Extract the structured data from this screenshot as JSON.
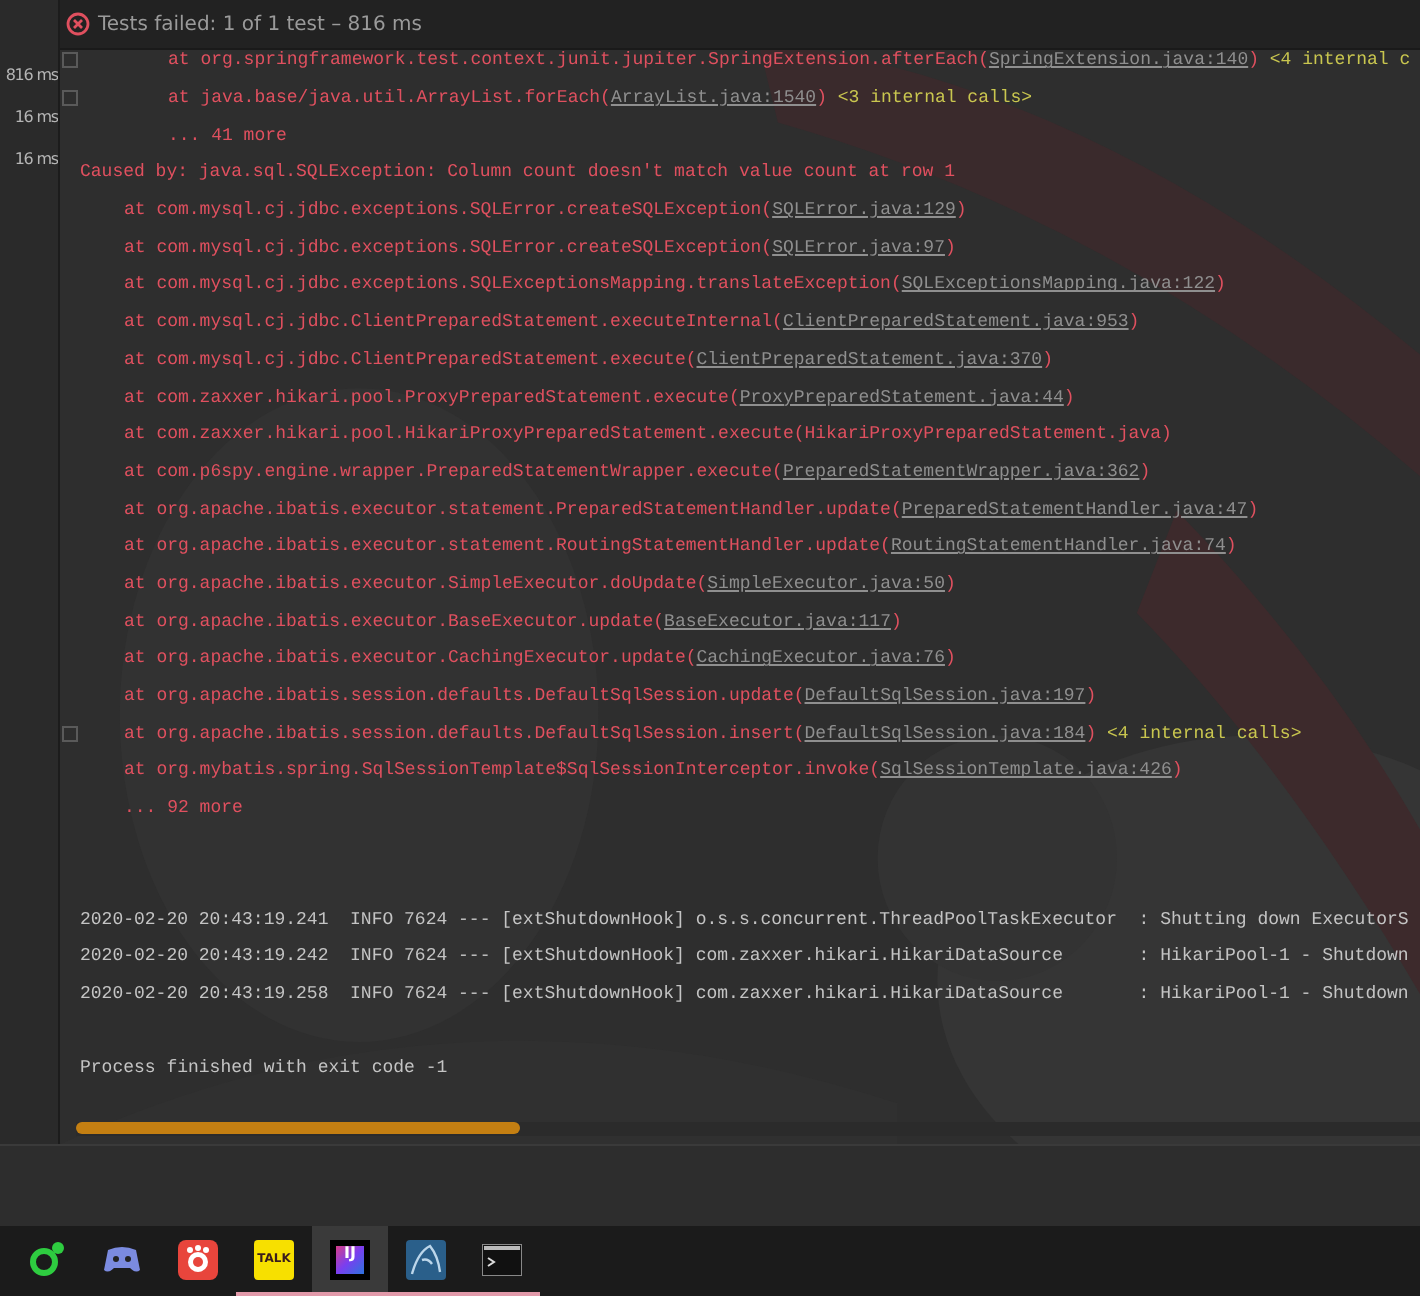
{
  "durations": [
    "816 ms",
    "16 ms",
    "16 ms"
  ],
  "header": {
    "status": "Tests failed: 1 of 1 test – 816 ms"
  },
  "trace": {
    "frames": [
      {
        "call": "at org.springframework.test.context.junit.jupiter.SpringExtension.afterEach(",
        "link": "SpringExtension.java:140",
        "close": ")",
        "note": "<4 internal c",
        "fold": true
      },
      {
        "call": "at java.base/java.util.ArrayList.forEach(",
        "link": "ArrayList.java:1540",
        "close": ")",
        "note": "<3 internal calls>",
        "fold": true
      }
    ],
    "more": "... 41 more"
  },
  "cause": {
    "text": "Caused by: java.sql.SQLException: Column count doesn't match value count at row 1",
    "frames": [
      {
        "call": "at com.mysql.cj.jdbc.exceptions.SQLError.createSQLException(",
        "link": "SQLError.java:129",
        "close": ")",
        "fold": false
      },
      {
        "call": "at com.mysql.cj.jdbc.exceptions.SQLError.createSQLException(",
        "link": "SQLError.java:97",
        "close": ")",
        "fold": false
      },
      {
        "call": "at com.mysql.cj.jdbc.exceptions.SQLExceptionsMapping.translateException(",
        "link": "SQLExceptionsMapping.java:122",
        "close": ")",
        "fold": false
      },
      {
        "call": "at com.mysql.cj.jdbc.ClientPreparedStatement.executeInternal(",
        "link": "ClientPreparedStatement.java:953",
        "close": ")",
        "fold": false
      },
      {
        "call": "at com.mysql.cj.jdbc.ClientPreparedStatement.execute(",
        "link": "ClientPreparedStatement.java:370",
        "close": ")",
        "fold": false
      },
      {
        "call": "at com.zaxxer.hikari.pool.ProxyPreparedStatement.execute(",
        "link": "ProxyPreparedStatement.java:44",
        "close": ")",
        "fold": false
      },
      {
        "call": "at com.zaxxer.hikari.pool.HikariProxyPreparedStatement.execute(HikariProxyPreparedStatement.java)",
        "fold": false
      },
      {
        "call": "at com.p6spy.engine.wrapper.PreparedStatementWrapper.execute(",
        "link": "PreparedStatementWrapper.java:362",
        "close": ")",
        "fold": false
      },
      {
        "call": "at org.apache.ibatis.executor.statement.PreparedStatementHandler.update(",
        "link": "PreparedStatementHandler.java:47",
        "close": ")",
        "fold": false
      },
      {
        "call": "at org.apache.ibatis.executor.statement.RoutingStatementHandler.update(",
        "link": "RoutingStatementHandler.java:74",
        "close": ")",
        "fold": false
      },
      {
        "call": "at org.apache.ibatis.executor.SimpleExecutor.doUpdate(",
        "link": "SimpleExecutor.java:50",
        "close": ")",
        "fold": false
      },
      {
        "call": "at org.apache.ibatis.executor.BaseExecutor.update(",
        "link": "BaseExecutor.java:117",
        "close": ")",
        "fold": false
      },
      {
        "call": "at org.apache.ibatis.executor.CachingExecutor.update(",
        "link": "CachingExecutor.java:76",
        "close": ")",
        "fold": false
      },
      {
        "call": "at org.apache.ibatis.session.defaults.DefaultSqlSession.update(",
        "link": "DefaultSqlSession.java:197",
        "close": ")",
        "fold": false
      },
      {
        "call": "at org.apache.ibatis.session.defaults.DefaultSqlSession.insert(",
        "link": "DefaultSqlSession.java:184",
        "close": ")",
        "note": "<4 internal calls>",
        "fold": true
      },
      {
        "call": "at org.mybatis.spring.SqlSessionTemplate$SqlSessionInterceptor.invoke(",
        "link": "SqlSessionTemplate.java:426",
        "close": ")",
        "fold": false
      }
    ],
    "more": "... 92 more"
  },
  "log": [
    "2020-02-20 20:43:19.241  INFO 7624 --- [extShutdownHook] o.s.s.concurrent.ThreadPoolTaskExecutor  : Shutting down ExecutorS",
    "2020-02-20 20:43:19.242  INFO 7624 --- [extShutdownHook] com.zaxxer.hikari.HikariDataSource       : HikariPool-1 - Shutdown",
    "2020-02-20 20:43:19.258  INFO 7624 --- [extShutdownHook] com.zaxxer.hikari.HikariDataSource       : HikariPool-1 - Shutdown"
  ],
  "exit": "Process finished with exit code -1",
  "taskbar": [
    {
      "kind": "ring",
      "active": false,
      "running": false
    },
    {
      "kind": "controller",
      "active": false,
      "running": false
    },
    {
      "kind": "camera",
      "active": false,
      "running": false
    },
    {
      "kind": "talk",
      "label": "TALK",
      "active": false,
      "running": true
    },
    {
      "kind": "ide",
      "label": "IJ",
      "active": true,
      "running": true
    },
    {
      "kind": "dolphin",
      "active": false,
      "running": true
    },
    {
      "kind": "terminal",
      "active": false,
      "running": true
    }
  ]
}
